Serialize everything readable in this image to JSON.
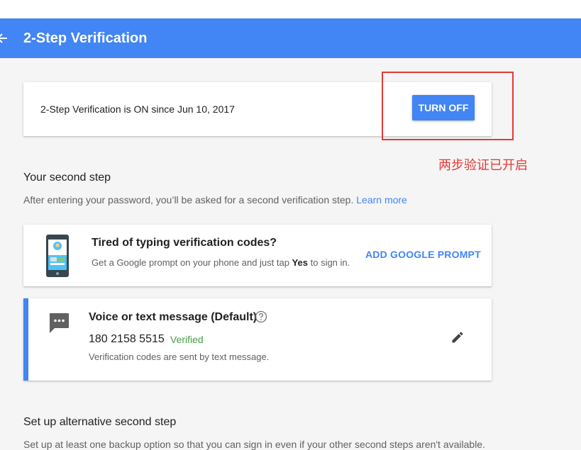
{
  "app_bar": {
    "title": "2-Step Verification",
    "back_icon": "arrow-left-icon",
    "color": "#4285f4"
  },
  "status": {
    "text": "2-Step Verification is ON since Jun 10, 2017",
    "turn_off_label": "TURN OFF"
  },
  "annotation": {
    "text": "两步验证已开启",
    "color": "#e53935"
  },
  "second_step": {
    "title": "Your second step",
    "description": "After entering your password, you’ll be asked for a second verification step.",
    "learn_more": "Learn more"
  },
  "prompt_card": {
    "icon": "phone-icon",
    "title": "Tired of typing verification codes?",
    "description_before": "Get a Google prompt on your phone and just tap ",
    "description_bold": "Yes",
    "description_after": " to sign in.",
    "button_label": "ADD GOOGLE PROMPT"
  },
  "voice_card": {
    "icon": "message-icon",
    "title": "Voice or text message (Default)",
    "help_icon": "help-circle-icon",
    "phone_number": "180 2158 5515",
    "status": "Verified",
    "status_color": "#43a047",
    "description": "Verification codes are sent by text message.",
    "edit_icon": "pencil-icon"
  },
  "alternative": {
    "title": "Set up alternative second step",
    "description": "Set up at least one backup option so that you can sign in even if your other second steps aren't available."
  }
}
